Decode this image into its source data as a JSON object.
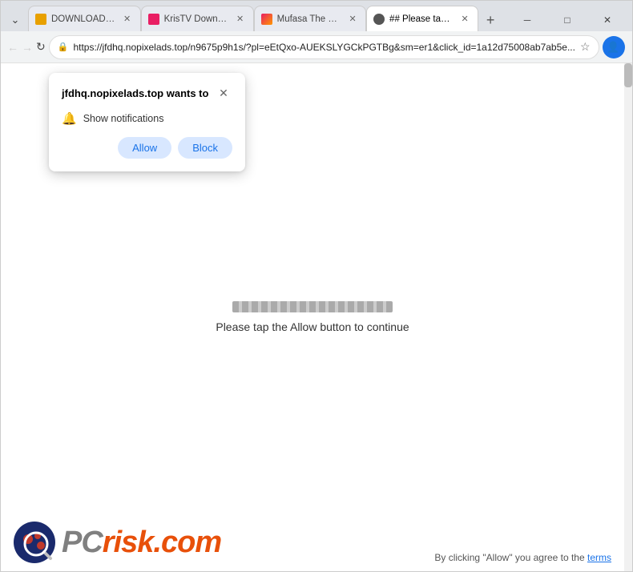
{
  "browser": {
    "tabs": [
      {
        "id": "tab1",
        "title": "DOWNLOAD: Mufas...",
        "favicon_type": "download",
        "active": false
      },
      {
        "id": "tab2",
        "title": "KrisTV Download Pa...",
        "favicon_type": "kris",
        "active": false
      },
      {
        "id": "tab3",
        "title": "Mufasa The Lion Kin...",
        "favicon_type": "mufasa",
        "active": false
      },
      {
        "id": "tab4",
        "title": "## Please tap the All...",
        "favicon_type": "active-fav",
        "active": true
      }
    ],
    "url": "https://jfdhq.nopixelads.top/n9675p9h1s/?pl=eEtQxo-AUEKSLYGCkPGTBg&sm=er1&click_id=1a12d75008ab7ab5e...",
    "window_controls": {
      "minimize": "─",
      "maximize": "□",
      "close": "✕"
    }
  },
  "notification_popup": {
    "domain": "jfdhq.nopixelads.top",
    "wants_to": " wants to",
    "close_label": "✕",
    "permission_text": "Show notifications",
    "allow_label": "Allow",
    "block_label": "Block"
  },
  "page": {
    "loading_text": "Please tap the Allow button to continue",
    "bottom_terms_text": "By clicking \"Allow\" you agree to the ",
    "terms_link": "terms"
  },
  "logo": {
    "pc_text": "PC",
    "risk_text": "risk",
    "dot_com": ".com"
  }
}
